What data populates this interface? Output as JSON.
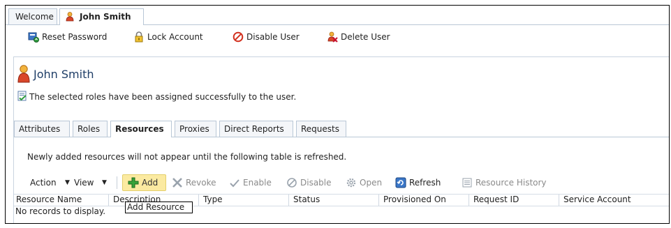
{
  "page_tabs": [
    {
      "label": "Welcome"
    },
    {
      "label": "John Smith"
    }
  ],
  "toolbar": {
    "reset_password": "Reset Password",
    "lock_account": "Lock Account",
    "disable_user": "Disable User",
    "delete_user": "Delete User"
  },
  "user": {
    "name": "John Smith"
  },
  "message": "The selected roles have been assigned successfully to the user.",
  "detail_tabs": [
    "Attributes",
    "Roles",
    "Resources",
    "Proxies",
    "Direct Reports",
    "Requests"
  ],
  "resources": {
    "info": "Newly added resources will not appear until the following table is refreshed.",
    "action_menu": "Action",
    "view_menu": "View",
    "add": "Add",
    "revoke": "Revoke",
    "enable": "Enable",
    "disable": "Disable",
    "open": "Open",
    "refresh": "Refresh",
    "resource_history": "Resource History",
    "columns": [
      "Resource Name",
      "Description",
      "Type",
      "Status",
      "Provisioned On",
      "Request ID",
      "Service Account"
    ],
    "empty_text": "No records to display.",
    "tooltip": "Add Resource"
  }
}
